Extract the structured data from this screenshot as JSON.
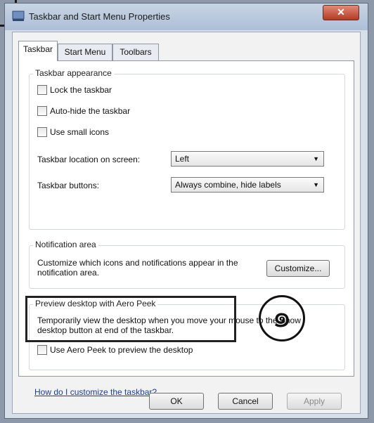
{
  "window": {
    "title": "Taskbar and Start Menu Properties",
    "close_label": "✕"
  },
  "tabs": [
    {
      "label": "Taskbar",
      "active": true
    },
    {
      "label": "Start Menu",
      "active": false
    },
    {
      "label": "Toolbars",
      "active": false
    }
  ],
  "taskbar_appearance": {
    "title": "Taskbar appearance",
    "lock": {
      "label": "Lock the taskbar",
      "checked": false
    },
    "autohide": {
      "label": "Auto-hide the taskbar",
      "checked": false
    },
    "small_icons": {
      "label": "Use small icons",
      "checked": false
    },
    "location": {
      "label": "Taskbar location on screen:",
      "value": "Left"
    },
    "buttons": {
      "label": "Taskbar buttons:",
      "value": "Always combine, hide labels"
    }
  },
  "notification_area": {
    "title": "Notification area",
    "description": "Customize which icons and notifications appear in the notification area.",
    "customize_label": "Customize..."
  },
  "aero_peek": {
    "title": "Preview desktop with Aero Peek",
    "description": "Temporarily view the desktop when you move your mouse to the Show desktop button at end of the taskbar.",
    "checkbox": {
      "label": "Use Aero Peek to preview the desktop",
      "checked": false
    }
  },
  "help_link": "How do I customize the taskbar?",
  "footer": {
    "ok": "OK",
    "cancel": "Cancel",
    "apply": "Apply"
  },
  "annotation": {
    "marker": "๑"
  }
}
